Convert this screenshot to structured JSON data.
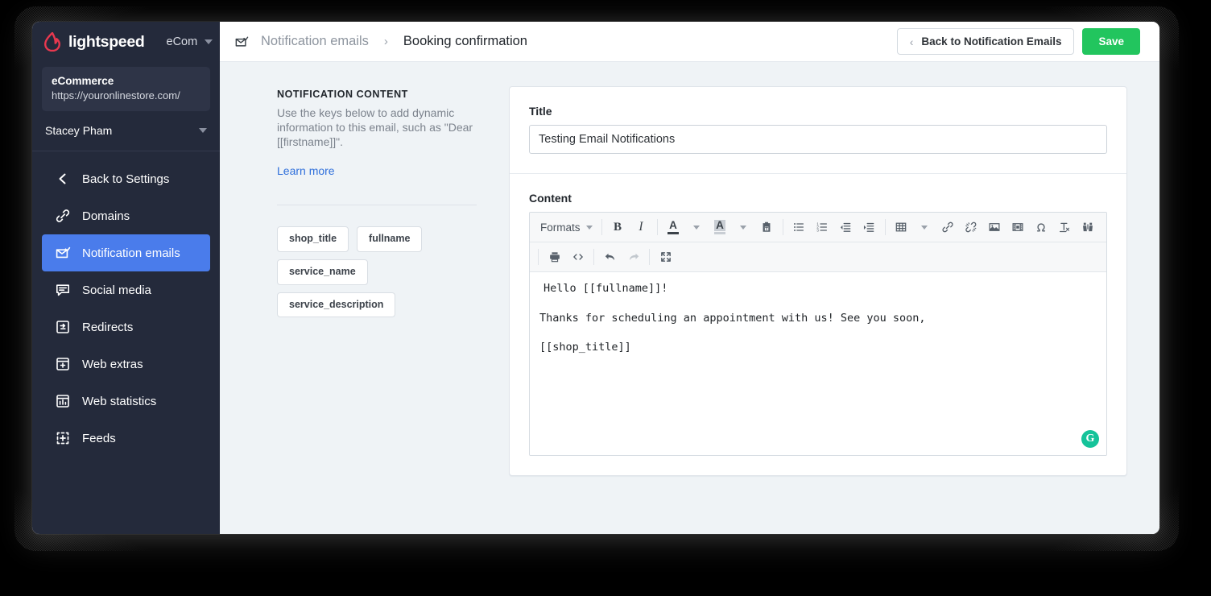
{
  "brand": {
    "logo_icon": "lightspeed-flame-logo",
    "name": "lightspeed",
    "product": "eCom",
    "switcher_icon": "caret-down-icon"
  },
  "store": {
    "name": "eCommerce",
    "url": "https://youronlinestore.com/"
  },
  "user": {
    "name": "Stacey Pham",
    "menu_icon": "caret-down-icon"
  },
  "sidebar": {
    "items": [
      {
        "label": "Back to Settings",
        "icon": "chevron-left-icon",
        "active": false
      },
      {
        "label": "Domains",
        "icon": "link-icon",
        "active": false
      },
      {
        "label": "Notification emails",
        "icon": "envelope-check-icon",
        "active": true
      },
      {
        "label": "Social media",
        "icon": "chat-bubble-icon",
        "active": false
      },
      {
        "label": "Redirects",
        "icon": "redirect-icon",
        "active": false
      },
      {
        "label": "Web extras",
        "icon": "browser-plus-icon",
        "active": false
      },
      {
        "label": "Web statistics",
        "icon": "bar-chart-icon",
        "active": false
      },
      {
        "label": "Feeds",
        "icon": "dotted-square-plus-icon",
        "active": false
      }
    ],
    "active_color": "#4a7ceb",
    "background_color": "#242a3b"
  },
  "topbar": {
    "breadcrumb_icon": "envelope-check-icon",
    "breadcrumb_parent": "Notification emails",
    "breadcrumb_separator": "›",
    "breadcrumb_current": "Booking confirmation",
    "back_button": {
      "label": "Back to Notification Emails",
      "icon": "chevron-left-icon"
    },
    "save_button": {
      "label": "Save",
      "color": "#22c55e"
    }
  },
  "info_panel": {
    "heading": "NOTIFICATION CONTENT",
    "description": "Use the keys below to add dynamic information to this email, such as \"Dear [[firstname]]\".",
    "learn_more": "Learn more",
    "learn_more_color": "#2f6fdb",
    "keys": [
      "shop_title",
      "fullname",
      "service_name",
      "service_description"
    ]
  },
  "form": {
    "title_label": "Title",
    "title_value": "Testing Email Notifications",
    "title_placeholder": "Title",
    "content_label": "Content"
  },
  "editor": {
    "toolbar_row1": [
      {
        "name": "formats-dropdown",
        "label": "Formats",
        "icon": "caret-down-icon"
      },
      {
        "name": "bold-button",
        "label": "B",
        "icon": "bold-icon"
      },
      {
        "name": "italic-button",
        "label": "I",
        "icon": "italic-icon"
      },
      {
        "name": "text-color-button",
        "label": "A",
        "icon": "text-color-icon"
      },
      {
        "name": "background-color-button",
        "label": "A",
        "icon": "background-color-icon"
      },
      {
        "name": "paste-as-text-button",
        "icon": "clipboard-text-icon"
      },
      {
        "name": "bullet-list-button",
        "icon": "bullet-list-icon"
      },
      {
        "name": "numbered-list-button",
        "icon": "numbered-list-icon"
      },
      {
        "name": "outdent-button",
        "icon": "outdent-icon"
      },
      {
        "name": "indent-button",
        "icon": "indent-icon"
      },
      {
        "name": "table-button",
        "icon": "table-icon"
      },
      {
        "name": "insert-link-button",
        "icon": "link-icon"
      },
      {
        "name": "unlink-button",
        "icon": "unlink-icon"
      },
      {
        "name": "insert-image-button",
        "icon": "image-icon"
      },
      {
        "name": "insert-media-button",
        "icon": "media-icon"
      },
      {
        "name": "special-character-button",
        "icon": "omega-icon"
      },
      {
        "name": "clear-formatting-button",
        "icon": "clear-format-icon"
      },
      {
        "name": "search-replace-button",
        "icon": "binoculars-icon"
      }
    ],
    "toolbar_row2": [
      {
        "name": "print-button",
        "icon": "printer-icon"
      },
      {
        "name": "source-code-button",
        "icon": "source-code-icon"
      },
      {
        "name": "undo-button",
        "icon": "undo-icon",
        "disabled": false
      },
      {
        "name": "redo-button",
        "icon": "redo-icon",
        "disabled": true
      },
      {
        "name": "fullscreen-button",
        "icon": "fullscreen-icon"
      }
    ],
    "body_paragraphs": [
      "Hello [[fullname]]!",
      "Thanks for scheduling an appointment with us! See you soon,",
      "[[shop_title]]"
    ],
    "grammarly_badge": {
      "icon": "grammarly-icon",
      "label": "G",
      "color": "#15c39a"
    }
  }
}
